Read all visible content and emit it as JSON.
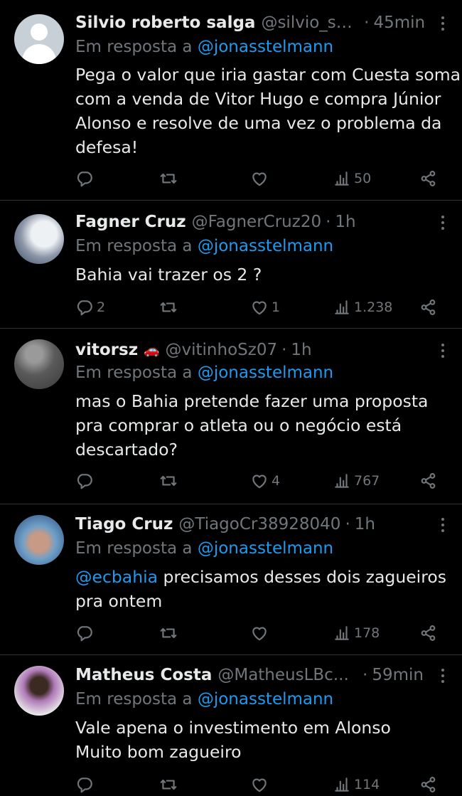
{
  "reply_prefix": "Em resposta a",
  "reply_target": "@jonasstelmann",
  "tweets": [
    {
      "name": "Silvio roberto salga",
      "handle": "@silvio_sal...",
      "time": "45min",
      "text_lines": [
        "Pega o valor que iria gastar com Cuesta soma",
        "com a venda de Vitor Hugo e compra Júnior",
        "Alonso e resolve de uma vez o problema da",
        "defesa!"
      ],
      "replies": "",
      "likes": "",
      "views": "50"
    },
    {
      "name": "Fagner Cruz",
      "handle": "@FagnerCruz20",
      "time": "1h",
      "text_lines": [
        "Bahia vai trazer os 2 ?"
      ],
      "replies": "2",
      "likes": "1",
      "views": "1.238"
    },
    {
      "name": "vitorsz",
      "name_emoji": "🚗",
      "handle": "@vitinhoSz07",
      "time": "1h",
      "text_lines": [
        "mas o Bahia pretende fazer uma proposta",
        "pra comprar o atleta ou o negócio está",
        "descartado?"
      ],
      "replies": "",
      "likes": "4",
      "views": "767"
    },
    {
      "name": "Tiago Cruz",
      "handle": "@TiagoCr38928040",
      "time": "1h",
      "text_mention": "@ecbahia",
      "text_lines": [
        " precisamos desses dois zagueiros",
        "pra ontem"
      ],
      "replies": "",
      "likes": "",
      "views": "178"
    },
    {
      "name": "Matheus Costa",
      "handle": "@MatheusLBc...",
      "time": "59min",
      "text_lines": [
        "Vale apena o investimento em Alonso",
        "Muito bom zagueiro"
      ],
      "replies": "",
      "likes": "",
      "views": "114"
    }
  ]
}
